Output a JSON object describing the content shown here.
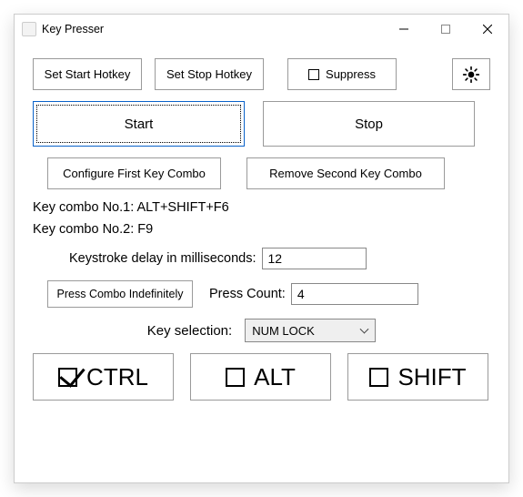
{
  "title": "Key Presser",
  "toolbar": {
    "set_start": "Set Start Hotkey",
    "set_stop": "Set Stop Hotkey",
    "suppress_label": "Suppress",
    "suppress_checked": false
  },
  "main": {
    "start": "Start",
    "stop": "Stop"
  },
  "config": {
    "first": "Configure First Key Combo",
    "second": "Remove Second Key Combo"
  },
  "combo1_label": "Key combo No.1: ALT+SHIFT+F6",
  "combo2_label": "Key combo No.2: F9",
  "delay": {
    "label": "Keystroke delay in milliseconds:",
    "value": "12"
  },
  "press": {
    "indef": "Press Combo Indefinitely",
    "count_label": "Press Count:",
    "count_value": "4"
  },
  "key_selection": {
    "label": "Key selection:",
    "value": "NUM LOCK"
  },
  "mods": {
    "ctrl": {
      "label": "CTRL",
      "checked": true
    },
    "alt": {
      "label": "ALT",
      "checked": false
    },
    "shift": {
      "label": "SHIFT",
      "checked": false
    }
  }
}
